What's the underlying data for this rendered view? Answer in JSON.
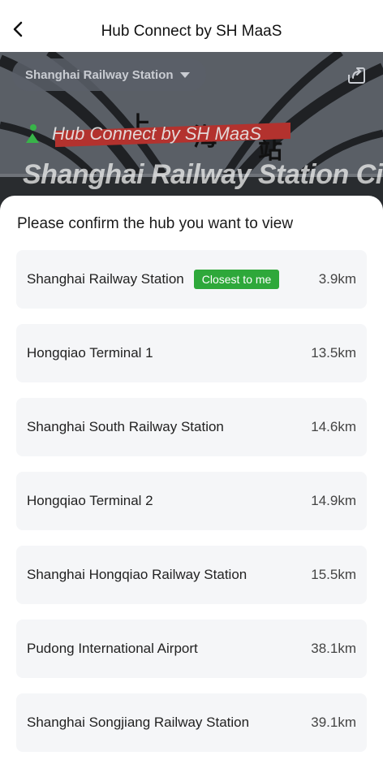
{
  "header": {
    "title": "Hub Connect by SH MaaS"
  },
  "hero": {
    "hub_selector": "Shanghai Railway Station",
    "sign_text": "Hub Connect by SH MaaS",
    "station_chars": [
      "上",
      "海",
      "站"
    ],
    "city_banner": "Shanghai Railway Station City"
  },
  "sheet": {
    "title": "Please confirm the hub you want to view",
    "hubs": [
      {
        "name": "Shanghai Railway Station",
        "badge": "Closest to me",
        "distance": "3.9km"
      },
      {
        "name": "Hongqiao Terminal 1",
        "distance": "13.5km"
      },
      {
        "name": "Shanghai South Railway Station",
        "distance": "14.6km"
      },
      {
        "name": "Hongqiao Terminal 2",
        "distance": "14.9km"
      },
      {
        "name": "Shanghai Hongqiao Railway Station",
        "distance": "15.5km"
      },
      {
        "name": "Pudong International Airport",
        "distance": "38.1km"
      },
      {
        "name": "Shanghai Songjiang Railway Station",
        "distance": "39.1km"
      }
    ]
  },
  "colors": {
    "badge_green": "#2ea83a",
    "row_bg": "#f5f6f8",
    "sign_red": "#b3322e"
  },
  "icons": {
    "back": "chevron-left-icon",
    "share": "share-icon",
    "dropdown": "caret-down-icon"
  }
}
